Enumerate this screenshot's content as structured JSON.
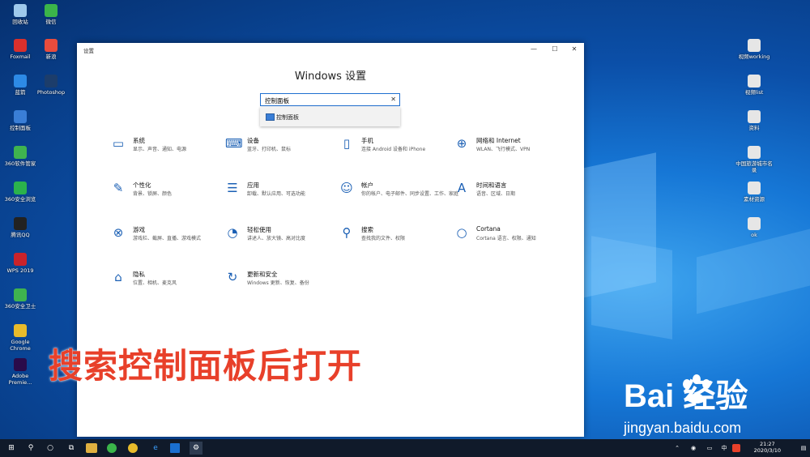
{
  "desktop": {
    "left_icons": [
      {
        "label": "回收站",
        "color": "#9ec9ec"
      },
      {
        "label": "微信",
        "color": "#3bb54a"
      },
      {
        "label": "Foxmail",
        "color": "#d9302c"
      },
      {
        "label": "新浪",
        "color": "#e84c3d"
      },
      {
        "label": "蓝箭",
        "color": "#2d8ae6"
      },
      {
        "label": "Photoshop",
        "color": "#1c3d6b"
      },
      {
        "label": "控制面板",
        "color": "#3a7ed6"
      },
      {
        "label": "360软件管家",
        "color": "#3fb34f"
      },
      {
        "label": "360安全浏览",
        "color": "#2bb24c"
      },
      {
        "label": "腾讯QQ",
        "color": "#222222"
      },
      {
        "label": "WPS 2019",
        "color": "#c9232b"
      },
      {
        "label": "360安全卫士",
        "color": "#3fb34f"
      },
      {
        "label": "Google Chrome",
        "color": "#e8bb2b"
      },
      {
        "label": "Adobe Premie...",
        "color": "#2a0b4a"
      }
    ],
    "right_icons": [
      {
        "label": "视频working",
        "color": "#e6e6e6"
      },
      {
        "label": "视频list",
        "color": "#e6e6e6"
      },
      {
        "label": "资料",
        "color": "#e6e6e6"
      },
      {
        "label": "中国旅游城市名录",
        "color": "#e6e6e6"
      },
      {
        "label": "素材资源",
        "color": "#e6e6e6"
      },
      {
        "label": "ok",
        "color": "#e6e6e6"
      }
    ]
  },
  "window": {
    "title": "设置",
    "minimize": "—",
    "maximize": "☐",
    "close": "✕",
    "heading": "Windows 设置",
    "search": {
      "value": "控制面板",
      "clear": "✕"
    },
    "suggestion": "控制面板",
    "categories": [
      {
        "name": "系统",
        "desc": "显示、声音、通知、电源",
        "icon": "laptop-icon"
      },
      {
        "name": "设备",
        "desc": "蓝牙、打印机、鼠标",
        "icon": "devices-icon"
      },
      {
        "name": "手机",
        "desc": "连接 Android 设备和 iPhone",
        "icon": "phone-icon"
      },
      {
        "name": "网络和 Internet",
        "desc": "WLAN、飞行模式、VPN",
        "icon": "globe-icon"
      },
      {
        "name": "个性化",
        "desc": "背景、锁屏、颜色",
        "icon": "personalize-icon"
      },
      {
        "name": "应用",
        "desc": "卸载、默认应用、可选功能",
        "icon": "apps-icon"
      },
      {
        "name": "帐户",
        "desc": "你的帐户、电子邮件、同步设置、工作、家庭",
        "icon": "account-icon"
      },
      {
        "name": "时间和语言",
        "desc": "语音、区域、日期",
        "icon": "time-language-icon"
      },
      {
        "name": "游戏",
        "desc": "游戏栏、截屏、直播、游戏模式",
        "icon": "xbox-icon"
      },
      {
        "name": "轻松使用",
        "desc": "讲述人、放大镜、高对比度",
        "icon": "ease-of-access-icon"
      },
      {
        "name": "搜索",
        "desc": "查找我的文件、权限",
        "icon": "search-icon"
      },
      {
        "name": "Cortana",
        "desc": "Cortana 语言、权限、通知",
        "icon": "cortana-icon"
      },
      {
        "name": "隐私",
        "desc": "位置、相机、麦克风",
        "icon": "lock-icon"
      },
      {
        "name": "更新和安全",
        "desc": "Windows 更新、恢复、备份",
        "icon": "update-icon"
      }
    ]
  },
  "overlay_caption": "搜索控制面板后打开",
  "watermark": {
    "logo": "Bai  经验",
    "url": "jingyan.baidu.com"
  },
  "taskbar": {
    "time": "21:27",
    "date": "2020/3/10"
  },
  "colors": {
    "accent": "#1f6fd0",
    "caption": "#e8402a",
    "icon_blue": "#1a5fb4"
  }
}
